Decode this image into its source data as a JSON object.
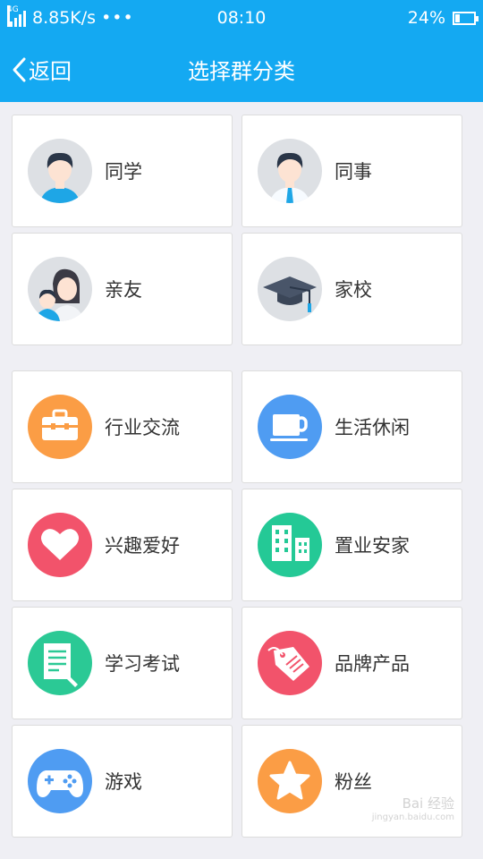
{
  "status_bar": {
    "network_type": "4G",
    "speed": "8.85K/s",
    "dots": "•••",
    "time": "08:10",
    "battery": "24%",
    "battery_level": 0.24
  },
  "nav": {
    "back_label": "返回",
    "title": "选择群分类"
  },
  "categories": [
    {
      "label": "同学",
      "icon": "student-avatar-icon",
      "color": "#dde0e4"
    },
    {
      "label": "同事",
      "icon": "coworker-avatar-icon",
      "color": "#dde0e4"
    },
    {
      "label": "亲友",
      "icon": "family-avatar-icon",
      "color": "#dde0e4"
    },
    {
      "label": "家校",
      "icon": "graduation-cap-icon",
      "color": "#dde0e4"
    },
    {
      "label": "行业交流",
      "icon": "briefcase-icon",
      "color": "#fb9d45"
    },
    {
      "label": "生活休闲",
      "icon": "coffee-cup-icon",
      "color": "#4f9cf2"
    },
    {
      "label": "兴趣爱好",
      "icon": "heart-icon",
      "color": "#f2536b"
    },
    {
      "label": "置业安家",
      "icon": "buildings-icon",
      "color": "#24c996"
    },
    {
      "label": "学习考试",
      "icon": "notebook-icon",
      "color": "#2bc995"
    },
    {
      "label": "品牌产品",
      "icon": "price-tag-icon",
      "color": "#f2536b"
    },
    {
      "label": "游戏",
      "icon": "gamepad-icon",
      "color": "#4f9cf2"
    },
    {
      "label": "粉丝",
      "icon": "star-icon",
      "color": "#fb9d45"
    }
  ],
  "watermark": {
    "line1": "Bai 经验",
    "line2": "jingyan.baidu.com"
  }
}
